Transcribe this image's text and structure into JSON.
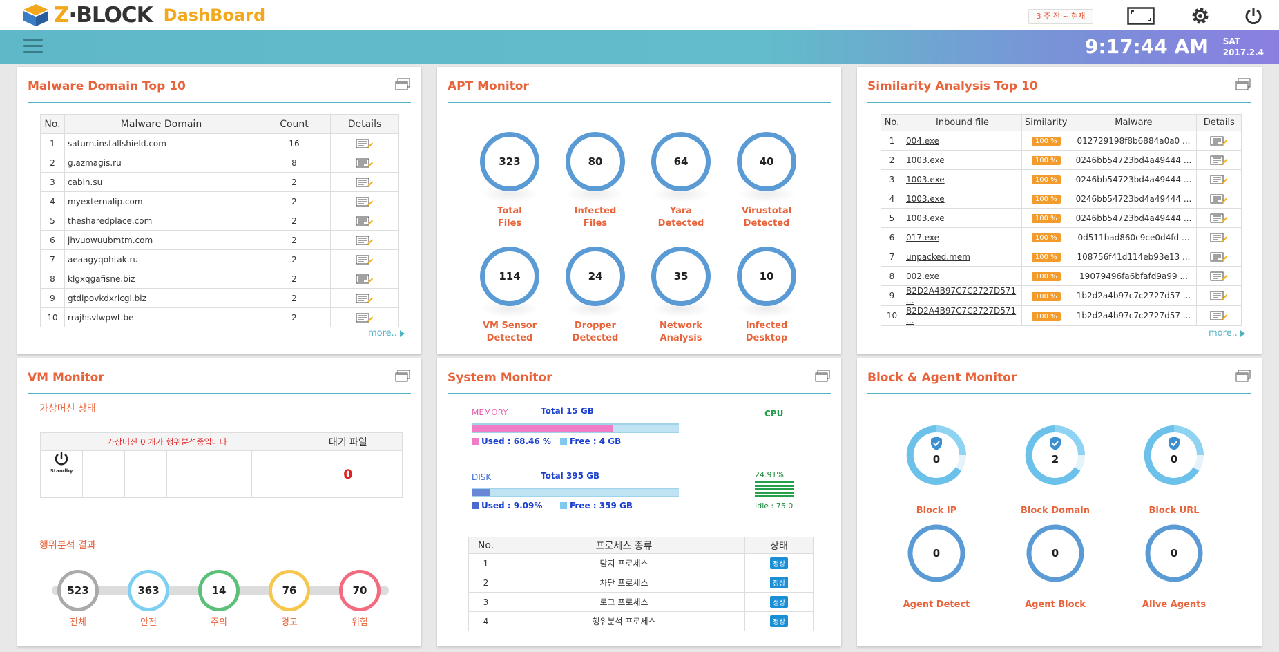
{
  "header": {
    "brand_z": "Z",
    "brand_block": "BLOCK",
    "dashboard_label": "DashBoard",
    "period_button": "3 주 전 ~ 현재",
    "clock": "9:17:44 AM",
    "day": "SAT",
    "date": "2017.2.4"
  },
  "malware_domain": {
    "title": "Malware Domain Top 10",
    "columns": [
      "No.",
      "Malware Domain",
      "Count",
      "Details"
    ],
    "rows": [
      {
        "no": "1",
        "domain": "saturn.installshield.com",
        "count": "16"
      },
      {
        "no": "2",
        "domain": "g.azmagis.ru",
        "count": "8"
      },
      {
        "no": "3",
        "domain": "cabin.su",
        "count": "2"
      },
      {
        "no": "4",
        "domain": "myexternalip.com",
        "count": "2"
      },
      {
        "no": "5",
        "domain": "thesharedplace.com",
        "count": "2"
      },
      {
        "no": "6",
        "domain": "jhvuowuubmtm.com",
        "count": "2"
      },
      {
        "no": "7",
        "domain": "aeaagyqohtak.ru",
        "count": "2"
      },
      {
        "no": "8",
        "domain": "klgxqgafisne.biz",
        "count": "2"
      },
      {
        "no": "9",
        "domain": "gtdipovkdxricgl.biz",
        "count": "2"
      },
      {
        "no": "10",
        "domain": "rrajhsvlwpwt.be",
        "count": "2"
      }
    ],
    "more": "more.."
  },
  "apt": {
    "title": "APT Monitor",
    "items": [
      {
        "value": "323",
        "label1": "Total",
        "label2": "Files"
      },
      {
        "value": "80",
        "label1": "Infected",
        "label2": "Files"
      },
      {
        "value": "64",
        "label1": "Yara",
        "label2": "Detected"
      },
      {
        "value": "40",
        "label1": "Virustotal",
        "label2": "Detected"
      },
      {
        "value": "114",
        "label1": "VM Sensor",
        "label2": "Detected"
      },
      {
        "value": "24",
        "label1": "Dropper",
        "label2": "Detected"
      },
      {
        "value": "35",
        "label1": "Network",
        "label2": "Analysis"
      },
      {
        "value": "10",
        "label1": "Infected",
        "label2": "Desktop"
      }
    ]
  },
  "similarity": {
    "title": "Similarity Analysis Top 10",
    "columns": [
      "No.",
      "Inbound file",
      "Similarity",
      "Malware",
      "Details"
    ],
    "rows": [
      {
        "no": "1",
        "file": "004.exe",
        "sim": "100 %",
        "malware": "012729198f8b6884a0a0 ..."
      },
      {
        "no": "2",
        "file": "1003.exe",
        "sim": "100 %",
        "malware": "0246bb54723bd4a49444 ..."
      },
      {
        "no": "3",
        "file": "1003.exe",
        "sim": "100 %",
        "malware": "0246bb54723bd4a49444 ..."
      },
      {
        "no": "4",
        "file": "1003.exe",
        "sim": "100 %",
        "malware": "0246bb54723bd4a49444 ..."
      },
      {
        "no": "5",
        "file": "1003.exe",
        "sim": "100 %",
        "malware": "0246bb54723bd4a49444 ..."
      },
      {
        "no": "6",
        "file": "017.exe",
        "sim": "100 %",
        "malware": "0d511bad860c9ce0d4fd ..."
      },
      {
        "no": "7",
        "file": "unpacked.mem",
        "sim": "100 %",
        "malware": "108756f41d114eb93e13 ..."
      },
      {
        "no": "8",
        "file": "002.exe",
        "sim": "100 %",
        "malware": "19079496fa6bfafd9a99 ..."
      },
      {
        "no": "9",
        "file": "B2D2A4B97C7C2727D571 ...",
        "sim": "100 %",
        "malware": "1b2d2a4b97c7c2727d57 ..."
      },
      {
        "no": "10",
        "file": "B2D2A4B97C7C2727D571 ...",
        "sim": "100 %",
        "malware": "1b2d2a4b97c7c2727d57 ..."
      }
    ],
    "more": "more.."
  },
  "vm": {
    "title": "VM Monitor",
    "state_title": "가상머신 상태",
    "analyzing_msg": "가상머신 0 개가 행위분석중입니다",
    "waiting_header": "대기 파일",
    "waiting_count": "0",
    "standby": "Standby",
    "result_title": "행위분석 결과",
    "results": [
      {
        "value": "523",
        "label": "전체",
        "color": "#aaaaaa"
      },
      {
        "value": "363",
        "label": "안전",
        "color": "#7ecff2"
      },
      {
        "value": "14",
        "label": "주의",
        "color": "#5cc07a"
      },
      {
        "value": "76",
        "label": "경고",
        "color": "#f7c64c"
      },
      {
        "value": "70",
        "label": "위험",
        "color": "#f36b7f"
      }
    ]
  },
  "system": {
    "title": "System Monitor",
    "memory_label": "MEMORY",
    "memory_total": "Total   15 GB",
    "memory_used": "Used : 68.46 %",
    "memory_free": "Free : 4 GB",
    "memory_used_pct": 0.6846,
    "disk_label": "DISK",
    "disk_total": "Total   395 GB",
    "disk_used": "Used : 9.09%",
    "disk_free": "Free : 359 GB",
    "disk_used_pct": 0.0909,
    "cpu_label": "CPU",
    "cpu_pct": "24.91%",
    "cpu_idle": "Idle : 75.0",
    "process_columns": [
      "No.",
      "프로세스 종류",
      "상태"
    ],
    "processes": [
      {
        "no": "1",
        "name": "탐지 프로세스",
        "state": "정상"
      },
      {
        "no": "2",
        "name": "차단 프로세스",
        "state": "정상"
      },
      {
        "no": "3",
        "name": "로그 프로세스",
        "state": "정상"
      },
      {
        "no": "4",
        "name": "행위분석 프로세스",
        "state": "정상"
      }
    ]
  },
  "block_agent": {
    "title": "Block & Agent Monitor",
    "blocks": [
      {
        "value": "0",
        "label": "Block IP"
      },
      {
        "value": "2",
        "label": "Block Domain"
      },
      {
        "value": "0",
        "label": "Block URL"
      }
    ],
    "agents": [
      {
        "value": "0",
        "label": "Agent Detect"
      },
      {
        "value": "0",
        "label": "Agent Block"
      },
      {
        "value": "0",
        "label": "Alive Agents"
      }
    ]
  },
  "colors": {
    "accent": "#e8633a",
    "teal": "#4fb3c3",
    "ring_blue": "#5b9bd5"
  }
}
